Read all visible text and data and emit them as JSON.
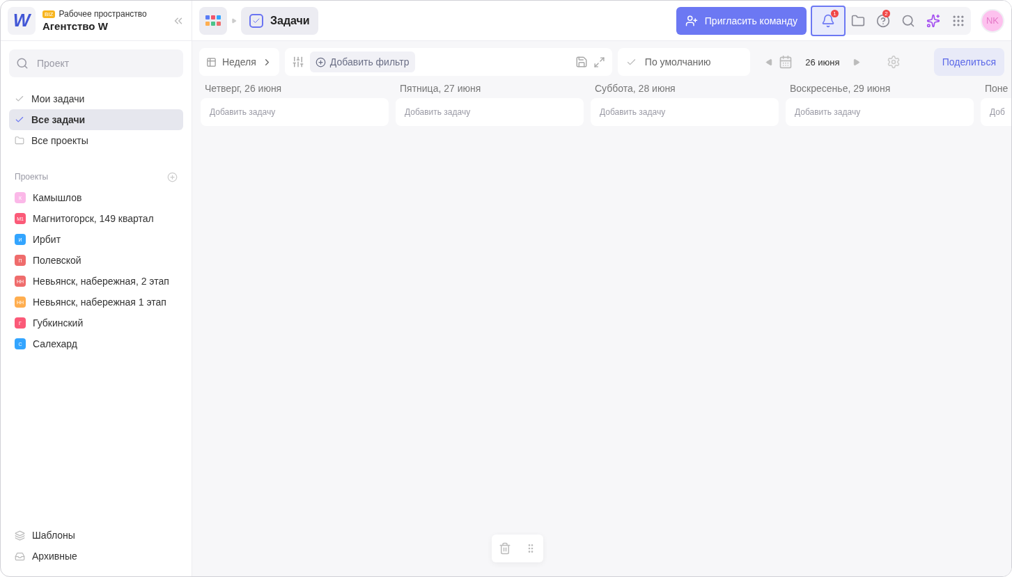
{
  "workspace": {
    "badge": "BIZ",
    "caption": "Рабочее пространство",
    "name": "Агентство W",
    "logo": "W"
  },
  "search": {
    "placeholder": "Проект"
  },
  "nav": [
    {
      "label": "Мои задачи",
      "selected": false
    },
    {
      "label": "Все задачи",
      "selected": true
    },
    {
      "label": "Все проекты",
      "selected": false
    }
  ],
  "projects_header": "Проекты",
  "projects": [
    {
      "abbr": "К",
      "name": "Камышлов",
      "color": "#fbb8e8"
    },
    {
      "abbr": "М1",
      "name": "Магнитогорск, 149 квартал",
      "color": "#fb5a78"
    },
    {
      "abbr": "И",
      "name": "Ирбит",
      "color": "#33a5ff"
    },
    {
      "abbr": "П",
      "name": "Полевской",
      "color": "#ef6c6c"
    },
    {
      "abbr": "НН",
      "name": "Невьянск, набережная, 2 этап",
      "color": "#ef6c6c"
    },
    {
      "abbr": "НН",
      "name": "Невьянск, набережная 1 этап",
      "color": "#ffae4f"
    },
    {
      "abbr": "Г",
      "name": "Губкинский",
      "color": "#fb5a78"
    },
    {
      "abbr": "С",
      "name": "Салехард",
      "color": "#33a5ff"
    }
  ],
  "footer": [
    {
      "label": "Шаблоны"
    },
    {
      "label": "Архивные"
    }
  ],
  "breadcrumb": {
    "title": "Задачи"
  },
  "invite_button": "Пригласить команду",
  "toolbar_icons": [
    {
      "badge": "1",
      "selected": true
    },
    {
      "selected": false
    },
    {
      "badge": "2",
      "selected": false
    },
    {
      "selected": false
    },
    {
      "selected": false
    },
    {
      "selected": false
    }
  ],
  "avatar": "NK",
  "view": {
    "label": "Неделя"
  },
  "filter": {
    "label": "Добавить фильтр"
  },
  "sort": {
    "label": "По умолчанию"
  },
  "date": {
    "label": "26 июня"
  },
  "share_button": "Поделиться",
  "columns": [
    {
      "title": "Четверг, 26 июня",
      "add": "Добавить задачу"
    },
    {
      "title": "Пятница, 27 июня",
      "add": "Добавить задачу"
    },
    {
      "title": "Суббота, 28 июня",
      "add": "Добавить задачу"
    },
    {
      "title": "Воскресенье, 29 июня",
      "add": "Добавить задачу"
    },
    {
      "title": "Поне",
      "add": "Доб"
    }
  ]
}
